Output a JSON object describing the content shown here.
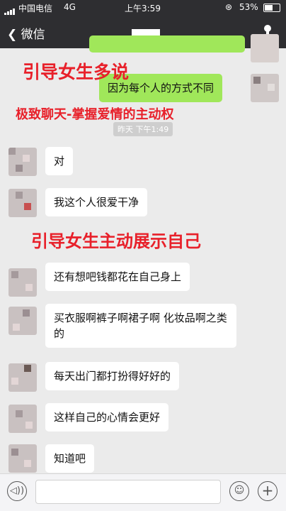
{
  "status": {
    "carrier": "中国电信",
    "network": "4G",
    "time": "上午3:59",
    "battery": "53%"
  },
  "nav": {
    "back_label": "微信"
  },
  "timestamp": "昨天 下午1:49",
  "messages": [
    {
      "text": "因为每个人的方式不同"
    },
    {
      "text": "对"
    },
    {
      "text": "我这个人很爱干净"
    },
    {
      "text": "还有想吧钱都花在自己身上"
    },
    {
      "text": "买衣服啊裤子啊裙子啊 化妆品啊之类的"
    },
    {
      "text": "每天出门都打扮得好好的"
    },
    {
      "text": "这样自己的心情会更好"
    },
    {
      "text": "知道吧"
    }
  ],
  "overlays": {
    "line1": "引导女生多说",
    "line2": "极致聊天-掌握爱情的主动权",
    "line3": "引导女生主动展示自己"
  },
  "colors": {
    "bubble_right": "#a0e75a",
    "overlay_text": "#e8202a",
    "bar": "#2e2e31"
  }
}
